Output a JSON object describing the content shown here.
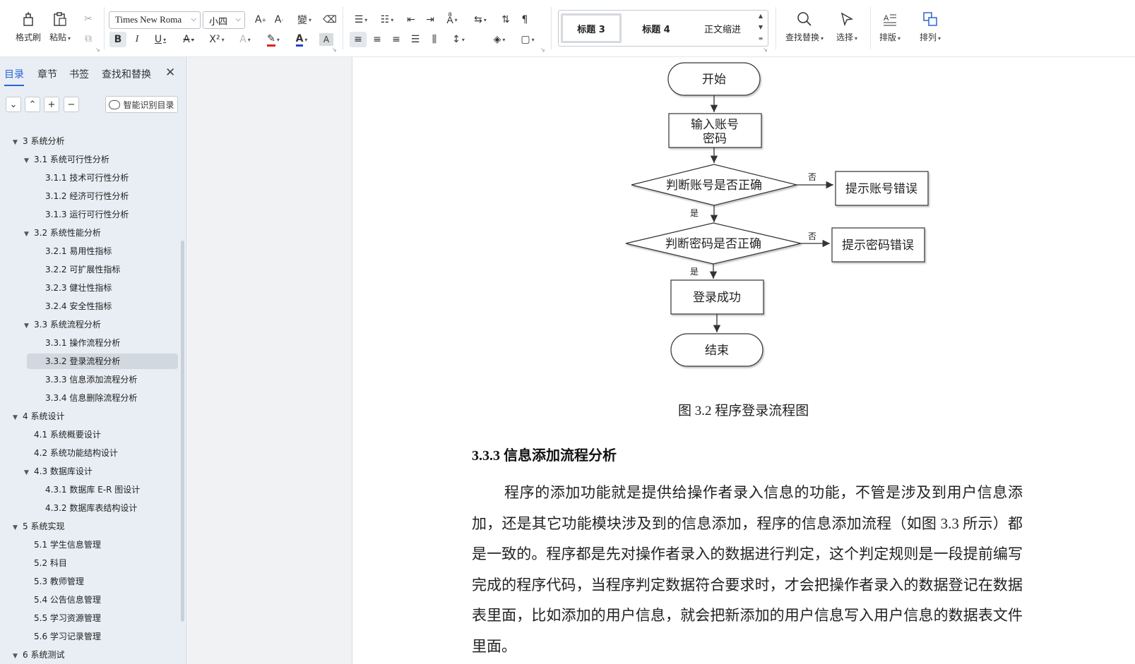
{
  "toolbar": {
    "format_painter": "格式刷",
    "paste": "粘贴",
    "font_name": "Times New Roma",
    "font_size": "小四",
    "find_replace": "查找替换",
    "select": "选择",
    "layout": "排版",
    "arrange": "排列"
  },
  "styles": {
    "items": [
      "标题 3",
      "标题 4",
      "正文缩进"
    ],
    "selected": "标题 3"
  },
  "nav": {
    "tabs": [
      "目录",
      "章节",
      "书签",
      "查找和替换"
    ],
    "active_tab": "目录",
    "smart_button": "智能识别目录",
    "toc": [
      {
        "label": "3  系统分析",
        "level": 0,
        "expanded": true
      },
      {
        "label": "3.1  系统可行性分析",
        "level": 1,
        "expanded": true
      },
      {
        "label": "3.1.1  技术可行性分析",
        "level": 2
      },
      {
        "label": "3.1.2  经济可行性分析",
        "level": 2
      },
      {
        "label": "3.1.3  运行可行性分析",
        "level": 2
      },
      {
        "label": "3.2  系统性能分析",
        "level": 1,
        "expanded": true
      },
      {
        "label": "3.2.1  易用性指标",
        "level": 2
      },
      {
        "label": "3.2.2  可扩展性指标",
        "level": 2
      },
      {
        "label": "3.2.3  健壮性指标",
        "level": 2
      },
      {
        "label": "3.2.4  安全性指标",
        "level": 2
      },
      {
        "label": "3.3  系统流程分析",
        "level": 1,
        "expanded": true
      },
      {
        "label": "3.3.1  操作流程分析",
        "level": 2
      },
      {
        "label": "3.3.2  登录流程分析",
        "level": 2,
        "selected": true
      },
      {
        "label": "3.3.3  信息添加流程分析",
        "level": 2
      },
      {
        "label": "3.3.4  信息删除流程分析",
        "level": 2
      },
      {
        "label": "4  系统设计",
        "level": 0,
        "expanded": true
      },
      {
        "label": "4.1  系统概要设计",
        "level": 1
      },
      {
        "label": "4.2  系统功能结构设计",
        "level": 1
      },
      {
        "label": "4.3  数据库设计",
        "level": 1,
        "expanded": true
      },
      {
        "label": "4.3.1  数据库 E-R 图设计",
        "level": 2
      },
      {
        "label": "4.3.2  数据库表结构设计",
        "level": 2
      },
      {
        "label": "5  系统实现",
        "level": 0,
        "expanded": true
      },
      {
        "label": "5.1  学生信息管理",
        "level": 1
      },
      {
        "label": "5.2  科目",
        "level": 1
      },
      {
        "label": "5.3  教师管理",
        "level": 1
      },
      {
        "label": "5.4  公告信息管理",
        "level": 1
      },
      {
        "label": "5.5  学习资源管理",
        "level": 1
      },
      {
        "label": "5.6  学习记录管理",
        "level": 1
      },
      {
        "label": "6  系统测试",
        "level": 0,
        "expanded": true
      }
    ]
  },
  "flowchart": {
    "start": "开始",
    "input_line1": "输入账号",
    "input_line2": "密码",
    "check_account": "判断账号是否正确",
    "account_error": "提示账号错误",
    "check_password": "判断密码是否正确",
    "password_error": "提示密码错误",
    "success": "登录成功",
    "end": "结束",
    "no": "否",
    "yes": "是"
  },
  "document": {
    "caption": "图 3.2  程序登录流程图",
    "heading": "3.3.3  信息添加流程分析",
    "paragraph": "程序的添加功能就是提供给操作者录入信息的功能，不管是涉及到用户信息添加，还是其它功能模块涉及到的信息添加，程序的信息添加流程（如图 3.3 所示）都是一致的。程序都是先对操作者录入的数据进行判定，这个判定规则是一段提前编写完成的程序代码，当程序判定数据符合要求时，才会把操作者录入的数据登记在数据表里面，比如添加的用户信息，就会把新添加的用户信息写入用户信息的数据表文件里面。"
  }
}
